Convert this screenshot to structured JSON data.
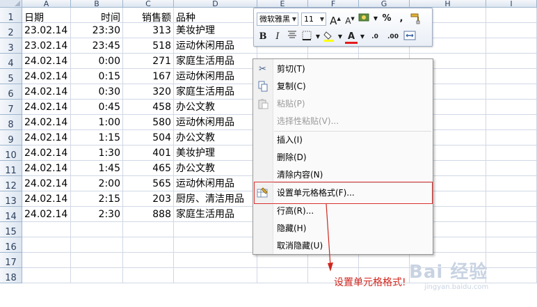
{
  "columns": [
    "A",
    "B",
    "C",
    "D",
    "E",
    "F",
    "G",
    "H",
    "I"
  ],
  "rows": [
    1,
    2,
    3,
    4,
    5,
    6,
    7,
    8,
    9,
    10,
    11,
    12,
    13,
    14,
    15,
    16,
    17,
    18
  ],
  "table": {
    "headers": [
      "日期",
      "时间",
      "销售额",
      "品种"
    ],
    "records": [
      [
        "23.02.14",
        "23:30",
        "313",
        "美妆护理"
      ],
      [
        "23.02.14",
        "23:45",
        "518",
        "运动休闲用品"
      ],
      [
        "24.02.14",
        "0:00",
        "271",
        "家庭生活用品"
      ],
      [
        "24.02.14",
        "0:15",
        "167",
        "运动休闲用品"
      ],
      [
        "24.02.14",
        "0:30",
        "320",
        "家庭生活用品"
      ],
      [
        "24.02.14",
        "0:45",
        "458",
        "办公文教"
      ],
      [
        "24.02.14",
        "1:00",
        "580",
        "运动休闲用品"
      ],
      [
        "24.02.14",
        "1:15",
        "504",
        "办公文教"
      ],
      [
        "24.02.14",
        "1:30",
        "401",
        "美妆护理"
      ],
      [
        "24.02.14",
        "1:45",
        "465",
        "办公文教"
      ],
      [
        "24.02.14",
        "2:00",
        "565",
        "运动休闲用品"
      ],
      [
        "24.02.14",
        "2:15",
        "203",
        "厨房、清洁用品"
      ],
      [
        "24.02.14",
        "2:30",
        "888",
        "家庭生活用品"
      ]
    ]
  },
  "minitoolbar": {
    "font_name": "微软雅黑",
    "font_size": "11",
    "grow_font": "A",
    "shrink_font": "A",
    "percent": "%",
    "comma": ",",
    "bold": "B",
    "italic": "I",
    "font_color": "A",
    "inc_decimal": ".0",
    "dec_decimal": ".00"
  },
  "context_menu": {
    "items": [
      {
        "label": "剪切(T)",
        "icon": "scissors-icon",
        "disabled": false
      },
      {
        "label": "复制(C)",
        "icon": "copy-icon",
        "disabled": false
      },
      {
        "label": "粘贴(P)",
        "icon": "paste-icon",
        "disabled": true
      },
      {
        "label": "选择性粘贴(V)...",
        "icon": "",
        "disabled": true
      },
      {
        "label": "插入(I)",
        "icon": "",
        "disabled": false
      },
      {
        "label": "删除(D)",
        "icon": "",
        "disabled": false
      },
      {
        "label": "清除内容(N)",
        "icon": "",
        "disabled": false
      },
      {
        "label": "设置单元格格式(F)...",
        "icon": "format-cells-icon",
        "disabled": false
      },
      {
        "label": "行高(R)...",
        "icon": "",
        "disabled": false
      },
      {
        "label": "隐藏(H)",
        "icon": "",
        "disabled": false
      },
      {
        "label": "取消隐藏(U)",
        "icon": "",
        "disabled": false
      }
    ]
  },
  "annotation": {
    "callout": "设置单元格格式!",
    "color": "#d0261d"
  },
  "watermark": {
    "brand": "Bai 经验",
    "url": "jingyan.baidu.com"
  },
  "colors": {
    "grid_line": "#d0d7e5",
    "header_bg": "#dde5f0",
    "highlight_border": "#d9312e"
  }
}
